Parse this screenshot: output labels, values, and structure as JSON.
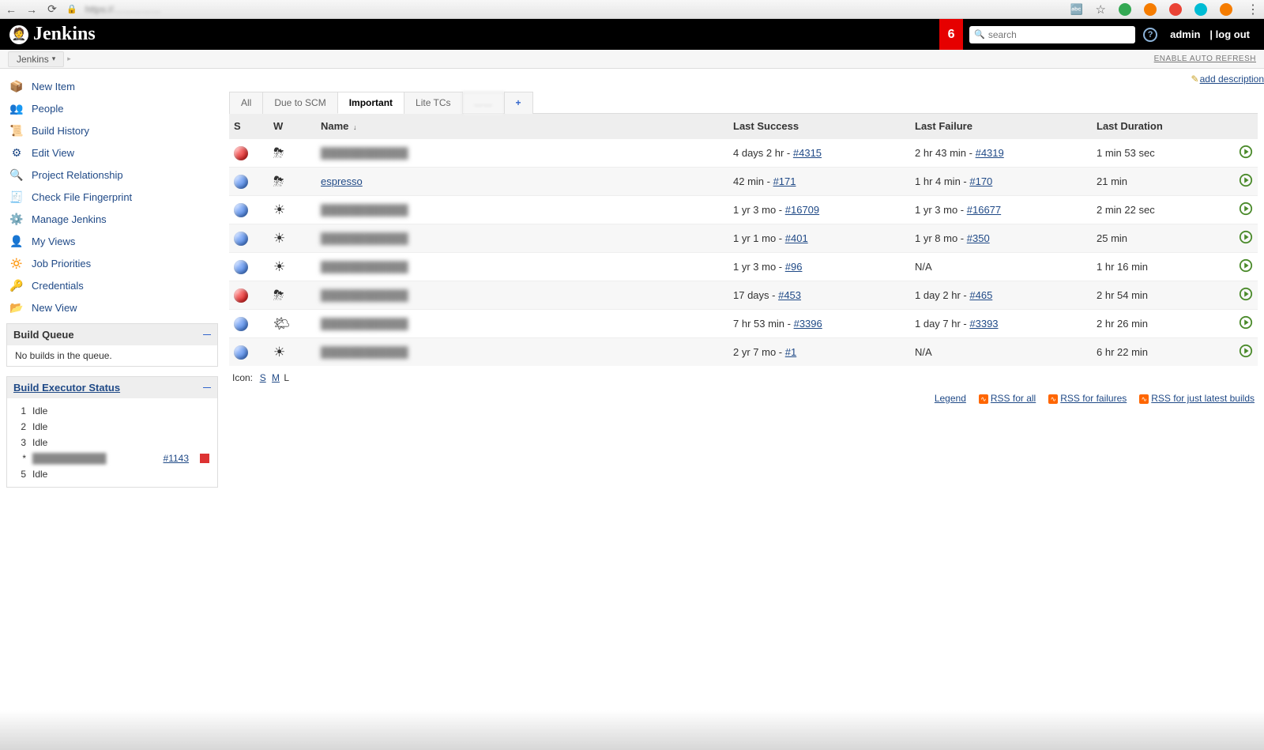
{
  "chrome": {
    "url_blurred": "https://……………"
  },
  "header": {
    "brand": "Jenkins",
    "alert_count": "6",
    "search_placeholder": "search",
    "user": "admin",
    "logout": "| log out"
  },
  "breadcrumb": {
    "root": "Jenkins",
    "auto_refresh": "ENABLE AUTO REFRESH"
  },
  "sidebar": {
    "items": [
      {
        "icon": "📦",
        "label": "New Item"
      },
      {
        "icon": "👥",
        "label": "People"
      },
      {
        "icon": "📜",
        "label": "Build History"
      },
      {
        "icon": "⚙",
        "label": "Edit View"
      },
      {
        "icon": "🔍",
        "label": "Project Relationship"
      },
      {
        "icon": "🧾",
        "label": "Check File Fingerprint"
      },
      {
        "icon": "⚙️",
        "label": "Manage Jenkins"
      },
      {
        "icon": "👤",
        "label": "My Views"
      },
      {
        "icon": "🔅",
        "label": "Job Priorities"
      },
      {
        "icon": "🔑",
        "label": "Credentials"
      },
      {
        "icon": "📂",
        "label": "New View"
      }
    ]
  },
  "build_queue": {
    "title": "Build Queue",
    "empty": "No builds in the queue."
  },
  "executors": {
    "title": "Build Executor Status",
    "rows": [
      {
        "n": "1",
        "state": "Idle"
      },
      {
        "n": "2",
        "state": "Idle"
      },
      {
        "n": "3",
        "state": "Idle"
      },
      {
        "n": "*",
        "state": "blurred",
        "build": "#1143"
      },
      {
        "n": "5",
        "state": "Idle"
      }
    ]
  },
  "add_description": "add description",
  "tabs": [
    "All",
    "Due to SCM",
    "Important",
    "Lite TCs",
    "……",
    "+"
  ],
  "active_tab": 2,
  "columns": {
    "s": "S",
    "w": "W",
    "name": "Name",
    "ls": "Last Success",
    "lf": "Last Failure",
    "ld": "Last Duration"
  },
  "jobs": [
    {
      "s": "red",
      "w": "⛈",
      "name": "blurred",
      "ls_t": "4 days 2 hr - ",
      "ls_b": "#4315",
      "lf_t": "2 hr 43 min - ",
      "lf_b": "#4319",
      "ld": "1 min 53 sec"
    },
    {
      "s": "blue",
      "w": "⛈",
      "name": "espresso",
      "ls_t": "42 min - ",
      "ls_b": "#171",
      "lf_t": "1 hr 4 min - ",
      "lf_b": "#170",
      "ld": "21 min"
    },
    {
      "s": "blue",
      "w": "☀",
      "name": "blurred",
      "ls_t": "1 yr 3 mo - ",
      "ls_b": "#16709",
      "lf_t": "1 yr 3 mo - ",
      "lf_b": "#16677",
      "ld": "2 min 22 sec"
    },
    {
      "s": "blue",
      "w": "☀",
      "name": "blurred",
      "ls_t": "1 yr 1 mo - ",
      "ls_b": "#401",
      "lf_t": "1 yr 8 mo - ",
      "lf_b": "#350",
      "ld": "25 min"
    },
    {
      "s": "blue",
      "w": "☀",
      "name": "blurred",
      "ls_t": "1 yr 3 mo - ",
      "ls_b": "#96",
      "lf_t": "N/A",
      "lf_b": "",
      "ld": "1 hr 16 min"
    },
    {
      "s": "red",
      "w": "⛈",
      "name": "blurred",
      "ls_t": "17 days - ",
      "ls_b": "#453",
      "lf_t": "1 day 2 hr - ",
      "lf_b": "#465",
      "ld": "2 hr 54 min"
    },
    {
      "s": "blue",
      "w": "🌤",
      "name": "blurred",
      "ls_t": "7 hr 53 min - ",
      "ls_b": "#3396",
      "lf_t": "1 day 7 hr - ",
      "lf_b": "#3393",
      "ld": "2 hr 26 min"
    },
    {
      "s": "blue",
      "w": "☀",
      "name": "blurred",
      "ls_t": "2 yr 7 mo - ",
      "ls_b": "#1",
      "lf_t": "N/A",
      "lf_b": "",
      "ld": "6 hr 22 min"
    }
  ],
  "icon_sizes": {
    "label": "Icon:",
    "s": "S",
    "m": "M",
    "l": "L"
  },
  "footer": {
    "legend": "Legend",
    "rss_all": "RSS for all",
    "rss_fail": "RSS for failures",
    "rss_latest": "RSS for just latest builds"
  }
}
